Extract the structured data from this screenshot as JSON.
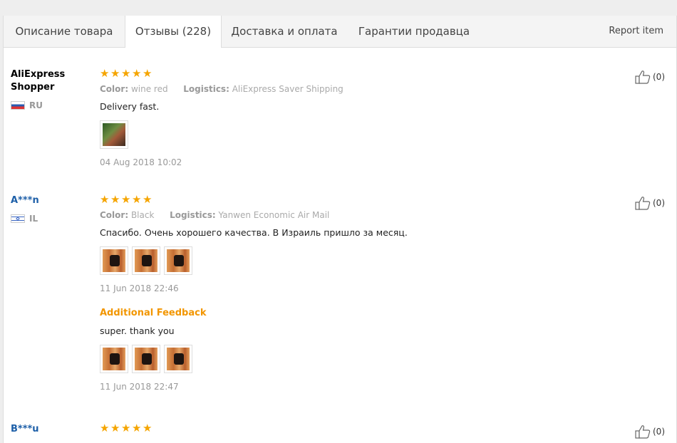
{
  "tabs": [
    {
      "label": "Описание товара"
    },
    {
      "label": "Отзывы (228)"
    },
    {
      "label": "Доставка и оплата"
    },
    {
      "label": "Гарантии продавца"
    }
  ],
  "report_label": "Report item",
  "labels": {
    "color": "Color:",
    "logistics": "Logistics:",
    "additional_feedback": "Additional Feedback"
  },
  "reviews": [
    {
      "user": "AliExpress Shopper",
      "country": "RU",
      "stars": 5,
      "color": "wine red",
      "logistics": "AliExpress Saver Shipping",
      "text": "Delivery fast.",
      "date": "04 Aug 2018 10:02",
      "likes": "(0)"
    },
    {
      "user": "A***n",
      "country": "IL",
      "stars": 5,
      "color": "Black",
      "logistics": "Yanwen Economic Air Mail",
      "text": "Спасибо. Очень хорошего качества. В Израиль пришло за месяц.",
      "date": "11 Jun 2018 22:46",
      "likes": "(0)",
      "additional": {
        "text": "super. thank you",
        "date": "11 Jun 2018 22:47"
      }
    },
    {
      "user": "B***u",
      "stars": 5,
      "likes": "(0)"
    }
  ],
  "colors": {
    "star": "#f5a500",
    "username_link": "#1d5fa8",
    "additional_label": "#f29600"
  }
}
